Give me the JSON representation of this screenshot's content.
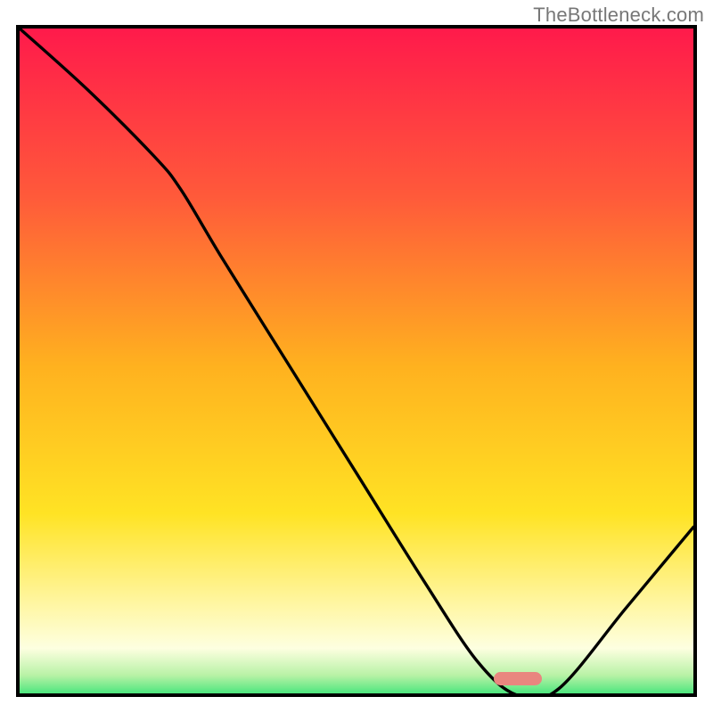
{
  "watermark": "TheBottleneck.com",
  "chart_data": {
    "type": "line",
    "title": "",
    "xlabel": "",
    "ylabel": "",
    "xlim": [
      0,
      100
    ],
    "ylim": [
      0,
      100
    ],
    "grid": false,
    "legend": false,
    "notes": "Background is a vertical heat gradient (red→orange→yellow→pale-yellow→green). A single black curve descends from top-left, has a slight elbow near x≈24, reaches a minimum near x≈74, then rises toward the right edge. A small rounded pink marker sits at the trough near the x-axis.",
    "series": [
      {
        "name": "curve",
        "x": [
          0,
          10,
          20,
          24,
          30,
          40,
          50,
          60,
          68,
          74,
          80,
          90,
          100
        ],
        "y": [
          100,
          91,
          81,
          76,
          66,
          50,
          34,
          18,
          6,
          1,
          2,
          14,
          26
        ]
      }
    ],
    "marker": {
      "x": 74,
      "y": 1,
      "color": "#e9867f",
      "shape": "rounded-bar"
    },
    "gradient_stops": [
      {
        "pos": 0.0,
        "color": "#ff1a4b"
      },
      {
        "pos": 0.25,
        "color": "#ff5a3a"
      },
      {
        "pos": 0.5,
        "color": "#ffb11f"
      },
      {
        "pos": 0.72,
        "color": "#ffe324"
      },
      {
        "pos": 0.86,
        "color": "#fff7a8"
      },
      {
        "pos": 0.92,
        "color": "#fdffe0"
      },
      {
        "pos": 0.96,
        "color": "#b8f2a6"
      },
      {
        "pos": 1.0,
        "color": "#19e06a"
      }
    ]
  }
}
